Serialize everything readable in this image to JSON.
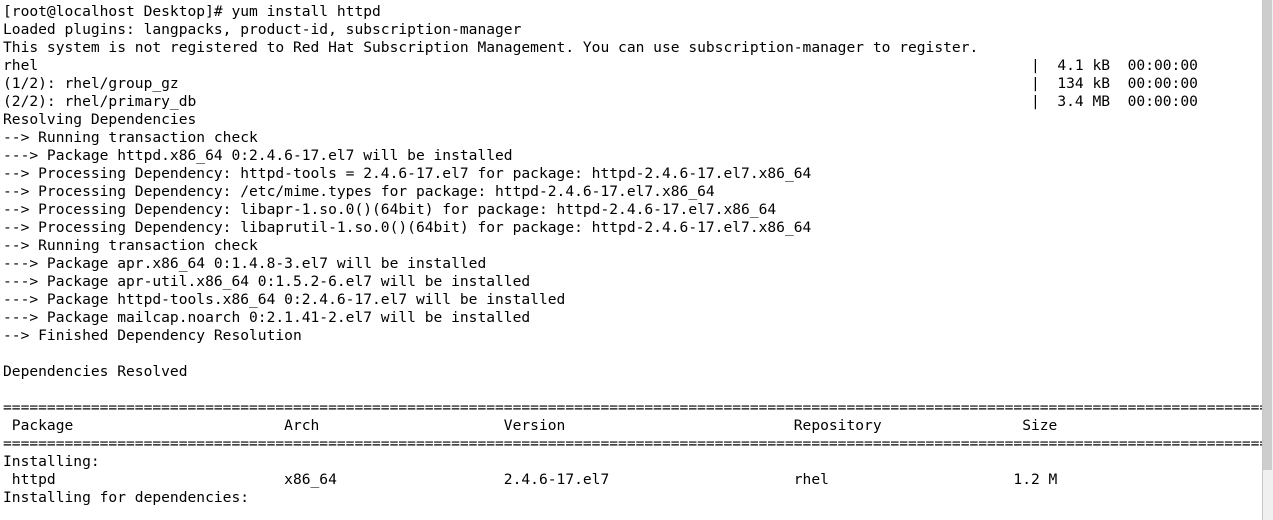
{
  "terminal": {
    "shell_prompt": "[root@localhost Desktop]# ",
    "command": "yum install httpd",
    "lines": [
      "[root@localhost Desktop]# yum install httpd",
      "Loaded plugins: langpacks, product-id, subscription-manager",
      "This system is not registered to Red Hat Subscription Management. You can use subscription-manager to register.",
      "rhel                                                                                                                 |  4.1 kB  00:00:00     ",
      "(1/2): rhel/group_gz                                                                                                 |  134 kB  00:00:00     ",
      "(2/2): rhel/primary_db                                                                                               |  3.4 MB  00:00:00     ",
      "Resolving Dependencies",
      "--> Running transaction check",
      "---> Package httpd.x86_64 0:2.4.6-17.el7 will be installed",
      "--> Processing Dependency: httpd-tools = 2.4.6-17.el7 for package: httpd-2.4.6-17.el7.x86_64",
      "--> Processing Dependency: /etc/mime.types for package: httpd-2.4.6-17.el7.x86_64",
      "--> Processing Dependency: libapr-1.so.0()(64bit) for package: httpd-2.4.6-17.el7.x86_64",
      "--> Processing Dependency: libaprutil-1.so.0()(64bit) for package: httpd-2.4.6-17.el7.x86_64",
      "--> Running transaction check",
      "---> Package apr.x86_64 0:1.4.8-3.el7 will be installed",
      "---> Package apr-util.x86_64 0:1.5.2-6.el7 will be installed",
      "---> Package httpd-tools.x86_64 0:2.4.6-17.el7 will be installed",
      "---> Package mailcap.noarch 0:2.1.41-2.el7 will be installed",
      "--> Finished Dependency Resolution",
      "",
      "Dependencies Resolved",
      "",
      "================================================================================================================================================================",
      " Package                        Arch                     Version                          Repository                Size",
      "================================================================================================================================================================",
      "Installing:",
      " httpd                          x86_64                   2.4.6-17.el7                     rhel                     1.2 M",
      "Installing for dependencies:"
    ],
    "repo_downloads": [
      {
        "name": "rhel",
        "size": "4.1 kB",
        "time": "00:00:00"
      },
      {
        "name": "(1/2): rhel/group_gz",
        "size": "134 kB",
        "time": "00:00:00"
      },
      {
        "name": "(2/2): rhel/primary_db",
        "size": "3.4 MB",
        "time": "00:00:00"
      }
    ],
    "package_table": {
      "headers": [
        "Package",
        "Arch",
        "Version",
        "Repository",
        "Size"
      ],
      "section_installing_label": "Installing:",
      "section_dependencies_label": "Installing for dependencies:",
      "rows": [
        {
          "package": "httpd",
          "arch": "x86_64",
          "version": "2.4.6-17.el7",
          "repository": "rhel",
          "size": "1.2 M"
        }
      ]
    },
    "colors": {
      "background": "#ffffff",
      "foreground": "#000000",
      "scrollbar_track": "#f0f0f0",
      "scrollbar_thumb": "#cdcdcd"
    }
  }
}
